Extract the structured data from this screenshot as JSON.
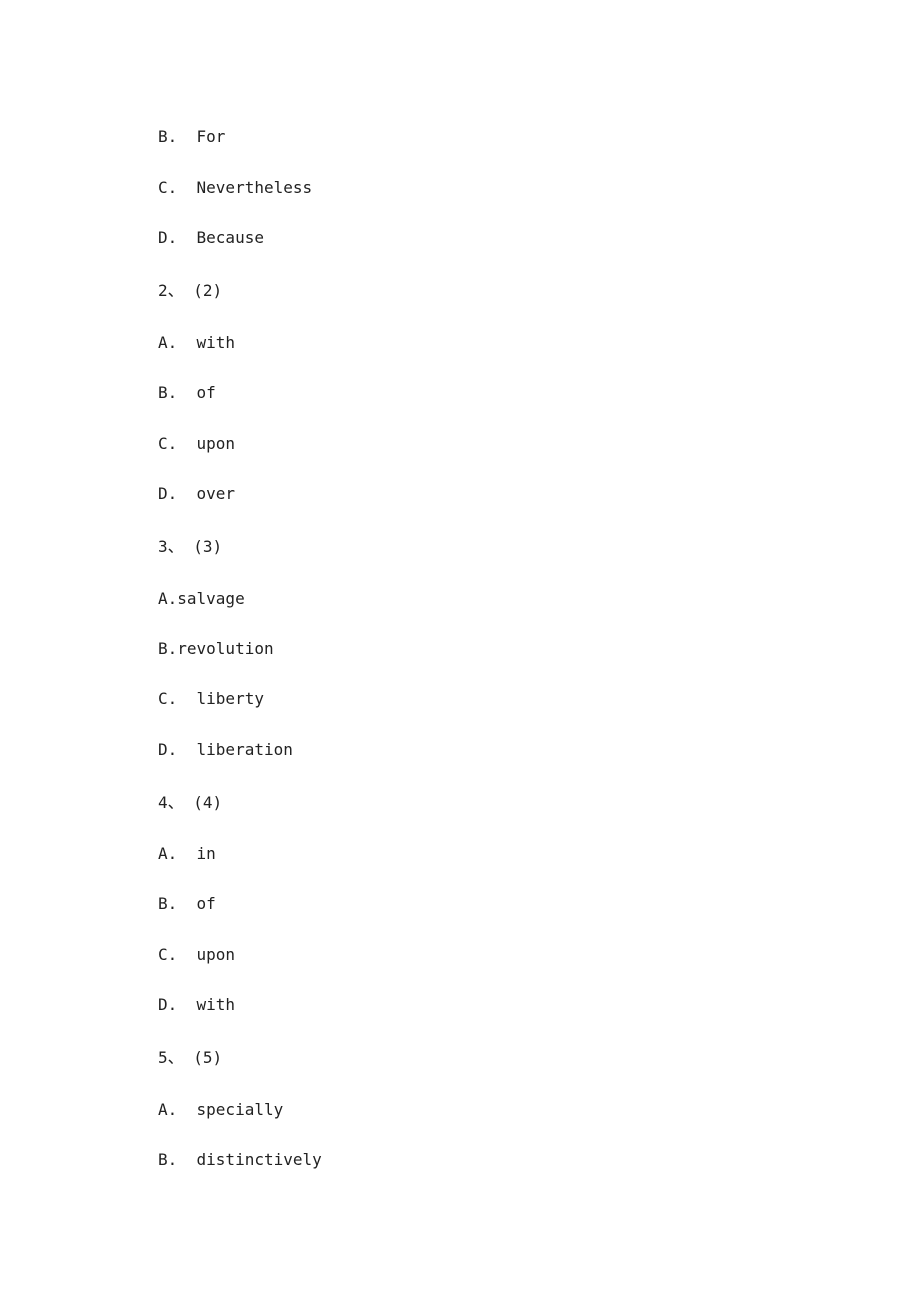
{
  "lines": [
    "B.  For",
    "C.  Nevertheless",
    "D.  Because",
    "2、 (2)",
    "A.  with",
    "B.  of",
    "C.  upon",
    "D.  over",
    "3、 (3)",
    "A.salvage",
    "B.revolution",
    "C.  liberty",
    "D.  liberation",
    "4、 (4)",
    "A.  in",
    "B.  of",
    "C.  upon",
    "D.  with",
    "5、 (5)",
    "A.  specially",
    "B.  distinctively"
  ]
}
